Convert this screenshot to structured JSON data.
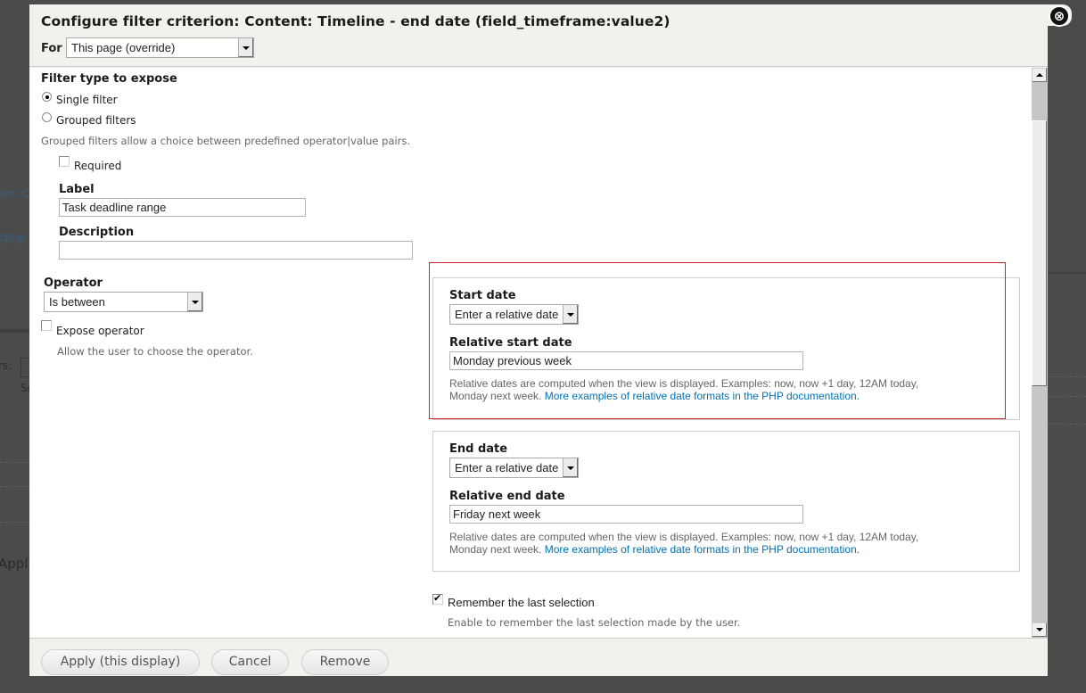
{
  "background": {
    "fragments": [
      "ser: C",
      "opup",
      "rs:",
      "Se",
      "Apply"
    ]
  },
  "dialog": {
    "title": "Configure filter criterion: Content: Timeline - end date (field_timeframe:value2)",
    "for_label": "For",
    "for_select_value": "This page (override)",
    "close_icon": "⊗"
  },
  "filter_type": {
    "heading": "Filter type to expose",
    "options": [
      {
        "label": "Single filter",
        "checked": true
      },
      {
        "label": "Grouped filters",
        "checked": false
      }
    ],
    "description": "Grouped filters allow a choice between predefined operator|value pairs."
  },
  "required": {
    "label": "Required",
    "checked": false
  },
  "label_field": {
    "label": "Label",
    "value": "Task deadline range"
  },
  "description_field": {
    "label": "Description",
    "value": ""
  },
  "operator": {
    "label": "Operator",
    "value": "Is between",
    "expose_label": "Expose operator",
    "expose_checked": false,
    "expose_description": "Allow the user to choose the operator."
  },
  "start_date": {
    "label": "Start date",
    "type_value": "Enter a relative date",
    "relative_label": "Relative start date",
    "relative_value": "Monday previous week",
    "help_text": "Relative dates are computed when the view is displayed. Examples: now, now +1 day, 12AM today,",
    "help_text_line2": "Monday next week.",
    "help_link": "More examples of relative date formats in the PHP documentation."
  },
  "end_date": {
    "label": "End date",
    "type_value": "Enter a relative date",
    "relative_label": "Relative end date",
    "relative_value": "Friday next week",
    "help_text": "Relative dates are computed when the view is displayed. Examples: now, now +1 day, 12AM today,",
    "help_text_line2": "Monday next week.",
    "help_link": "More examples of relative date formats in the PHP documentation."
  },
  "remember": {
    "label": "Remember the last selection",
    "checked": true,
    "description": "Enable to remember the last selection made by the user."
  },
  "footer": {
    "apply_label": "Apply (this display)",
    "cancel_label": "Cancel",
    "remove_label": "Remove"
  },
  "colors": {
    "highlight": "#d2232a",
    "link": "#0071b3",
    "overlay": "#4b4b4b",
    "dialog_bg": "#f2f2ed"
  }
}
